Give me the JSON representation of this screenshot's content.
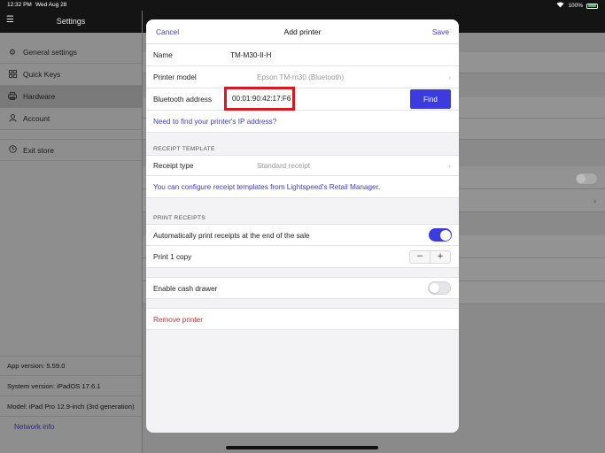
{
  "status_bar": {
    "time": "12:32 PM",
    "date": "Wed Aug 28",
    "battery": "100%"
  },
  "sidebar": {
    "title": "Settings",
    "items": [
      {
        "label": "General settings",
        "icon": "gear-icon"
      },
      {
        "label": "Quick Keys",
        "icon": "grid-icon"
      },
      {
        "label": "Hardware",
        "icon": "printer-icon"
      },
      {
        "label": "Account",
        "icon": "person-icon"
      },
      {
        "label": "Exit store",
        "icon": "clock-icon"
      }
    ],
    "info": {
      "app_version": "App version: 5.59.0",
      "system_version": "System version: iPadOS 17.6.1",
      "model": "Model: iPad Pro 12.9-inch (3rd generation)",
      "network_info": "Network info"
    }
  },
  "modal": {
    "cancel": "Cancel",
    "title": "Add printer",
    "save": "Save",
    "name_label": "Name",
    "name_value": "TM-M30-II-H",
    "model_label": "Printer model",
    "model_value": "Epson TM-m30 (Bluetooth)",
    "bt_label": "Bluetooth address",
    "bt_value": "00:01:90:42:17:F6",
    "find": "Find",
    "ip_link": "Need to find your printer's IP address?",
    "receipt_template_section": "RECEIPT TEMPLATE",
    "receipt_type_label": "Receipt type",
    "receipt_type_value": "Standard receipt",
    "template_link": "You can configure receipt templates from Lightspeed's Retail Manager.",
    "print_receipts_section": "PRINT RECEIPTS",
    "auto_print_label": "Automatically print receipts at the end of the sale",
    "auto_print_on": true,
    "copies_label": "Print 1 copy",
    "minus": "−",
    "plus": "+",
    "cash_drawer_label": "Enable cash drawer",
    "cash_drawer_on": false,
    "remove_printer": "Remove printer"
  },
  "colors": {
    "accent": "#3b3be0",
    "danger": "#d12b2b",
    "highlight_box": "#e0161c"
  }
}
